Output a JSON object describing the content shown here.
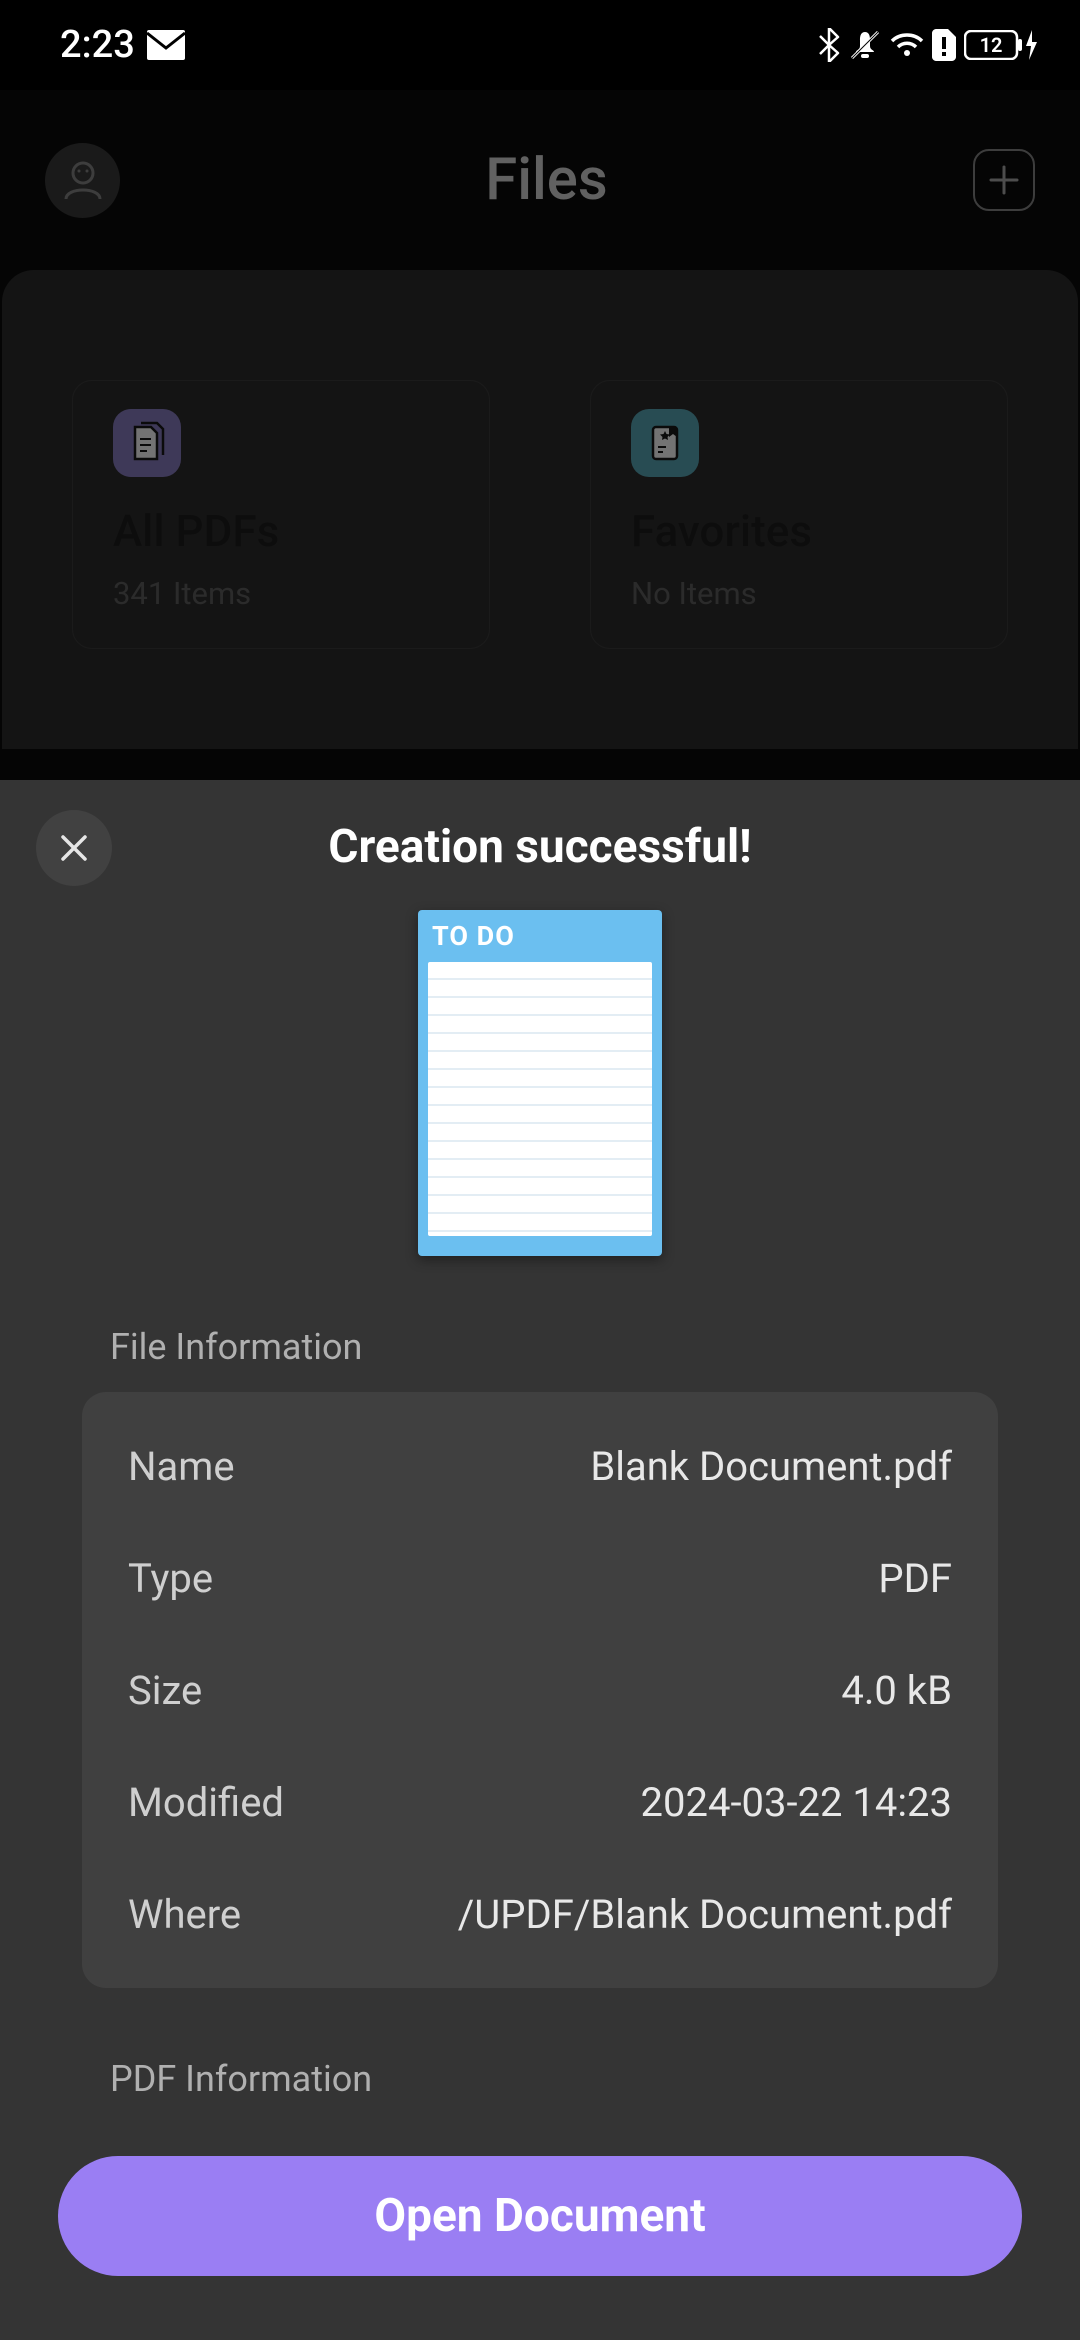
{
  "status": {
    "time": "2:23",
    "battery": "12"
  },
  "header": {
    "title": "Files"
  },
  "cards": {
    "all_pdfs": {
      "title": "All PDFs",
      "sub": "341 Items"
    },
    "favorites": {
      "title": "Favorites",
      "sub": "No Items"
    }
  },
  "sheet": {
    "title": "Creation successful!",
    "thumb_title": "TO DO",
    "file_section_label": "File Information",
    "pdf_section_label": "PDF Information",
    "info": {
      "name_label": "Name",
      "name_value": "Blank Document.pdf",
      "type_label": "Type",
      "type_value": "PDF",
      "size_label": "Size",
      "size_value": "4.0 kB",
      "modified_label": "Modified",
      "modified_value": "2024-03-22 14:23",
      "where_label": "Where",
      "where_value": "/UPDF/Blank Document.pdf"
    },
    "open_label": "Open Document"
  }
}
